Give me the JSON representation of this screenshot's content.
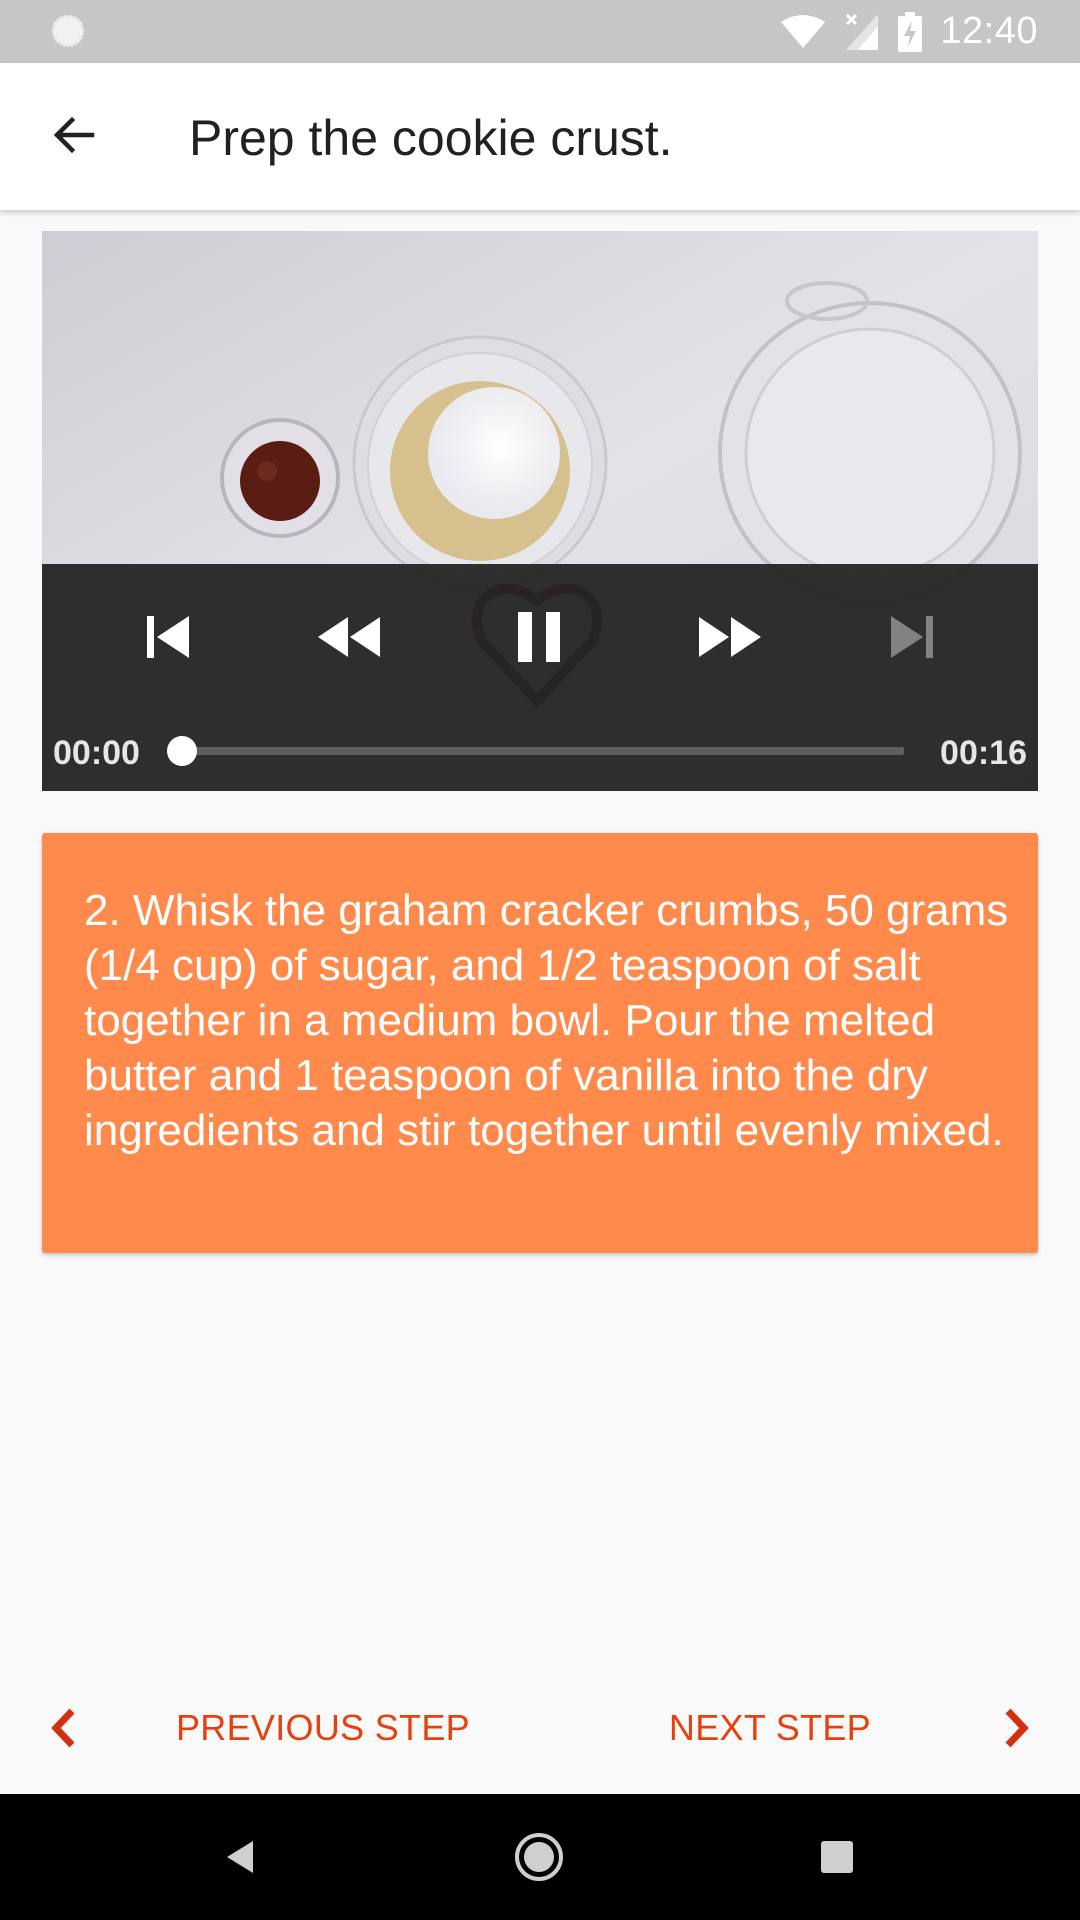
{
  "status_bar": {
    "time": "12:40",
    "icons": [
      "loading-circle-icon",
      "wifi-icon",
      "no-signal-icon",
      "battery-charging-icon"
    ]
  },
  "app_bar": {
    "title": "Prep the cookie crust.",
    "back_icon": "arrow-back-icon"
  },
  "video": {
    "controls": [
      "skip-previous-icon",
      "rewind-icon",
      "pause-icon",
      "fast-forward-icon",
      "skip-next-icon"
    ],
    "current_time": "00:00",
    "duration": "00:16",
    "progress": 0
  },
  "step": {
    "text": "2. Whisk the graham cracker crumbs, 50 grams (1/4 cup) of sugar, and 1/2 teaspoon of salt together in a medium bowl. Pour the melted butter and 1 teaspoon of vanilla into the dry ingredients and stir together until evenly mixed.",
    "card_color": "#ff8a4c"
  },
  "navigation": {
    "previous_label": "PREVIOUS STEP",
    "next_label": "NEXT STEP",
    "accent_color": "#e6400f"
  },
  "system_nav": [
    "back-triangle-icon",
    "home-circle-icon",
    "recents-square-icon"
  ]
}
